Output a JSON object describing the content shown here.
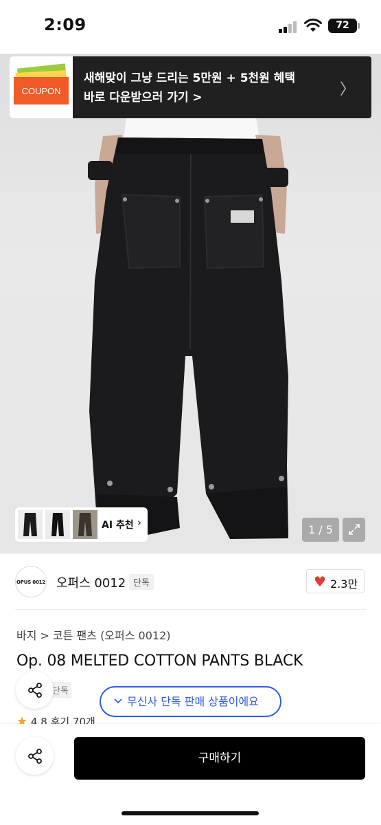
{
  "status": {
    "time": "2:09",
    "battery": "72"
  },
  "coupon": {
    "thumb_label": "COUPON",
    "line1": "새해맞이 그냥 드리는 5만원 + 5천원 혜택",
    "line2": "바로 다운받으러 가기 >",
    "chevron": "〉"
  },
  "gallery": {
    "ai_label": "AI 추천",
    "counter": "1 / 5"
  },
  "brand": {
    "logo_text": "OPUS 0012",
    "name": "오퍼스 0012",
    "badge": "단독"
  },
  "like": {
    "count": "2.3만"
  },
  "product": {
    "breadcrumb": "바지 > 코튼 팬츠 (오퍼스 0012)",
    "title": "Op. 08 MELTED COTTON PANTS BLACK",
    "partial_badge": "단독",
    "exclusive_notice": "무신사 단독 판매 상품이에요",
    "rating": "4.8",
    "reviews": "후기 70개"
  },
  "actions": {
    "buy_label": "구매하기"
  },
  "colors": {
    "accent": "#2f5bea",
    "heart": "#e53935",
    "banner": "#202020",
    "coupon": "#f15a29"
  }
}
